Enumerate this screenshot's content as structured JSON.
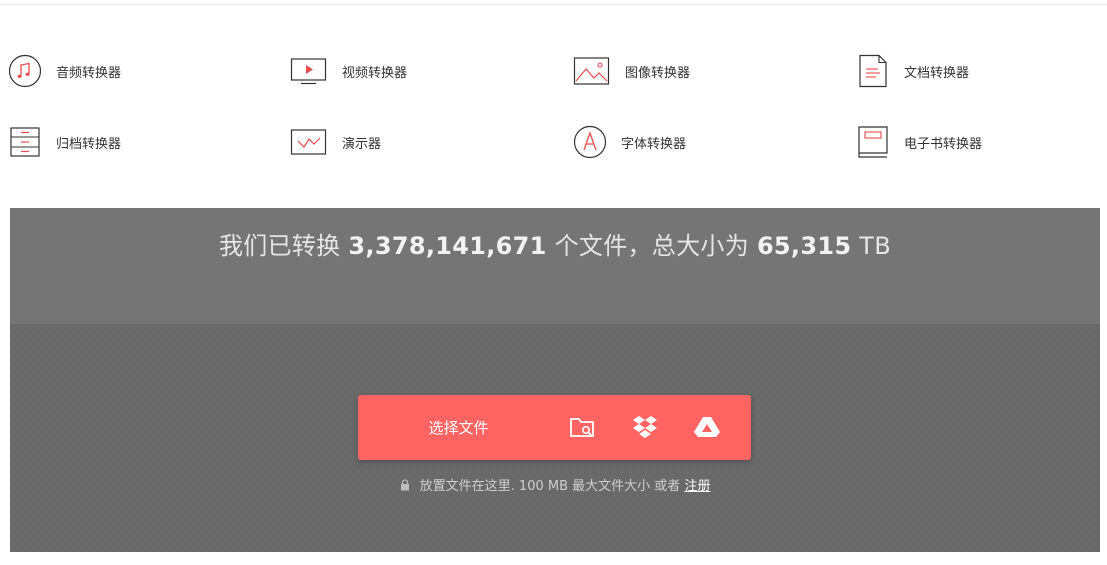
{
  "menu": {
    "items": [
      {
        "label": "音频转换器",
        "icon": "music-note-icon"
      },
      {
        "label": "视频转换器",
        "icon": "video-monitor-icon"
      },
      {
        "label": "图像转换器",
        "icon": "image-icon"
      },
      {
        "label": "文档转换器",
        "icon": "document-icon"
      },
      {
        "label": "归档转换器",
        "icon": "archive-icon"
      },
      {
        "label": "演示器",
        "icon": "presentation-icon"
      },
      {
        "label": "字体转换器",
        "icon": "font-icon"
      },
      {
        "label": "电子书转换器",
        "icon": "ebook-icon"
      }
    ]
  },
  "hero": {
    "stats_prefix": "我们已转换",
    "files_count": "3,378,141,671",
    "stats_middle": "个文件，总大小为",
    "total_size": "65,315",
    "size_unit": "TB"
  },
  "upload": {
    "choose_label": "选择文件",
    "sources": [
      "folder-search-icon",
      "dropbox-icon",
      "google-drive-icon"
    ]
  },
  "note": {
    "text": "放置文件在这里. 100 MB 最大文件大小 或者",
    "signup_link": "注册"
  },
  "colors": {
    "accent": "#ff6463",
    "hero_bg": "#757575",
    "hero_band": "#696969"
  }
}
